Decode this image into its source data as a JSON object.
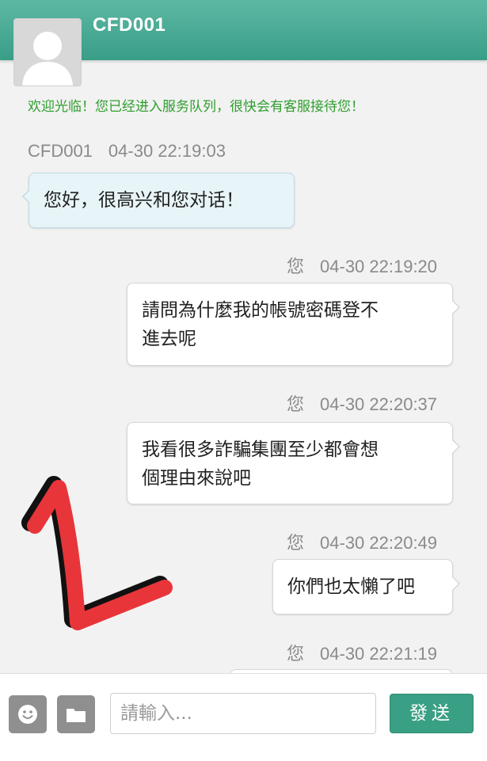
{
  "header": {
    "title": "CFD001",
    "bg_color": "#3fa58e"
  },
  "welcome_text": "欢迎光临！您已经进入服务队列，很快会有客服接待您！",
  "messages": [
    {
      "sender": "CFD001",
      "time": "04-30 22:19:03",
      "lines": [
        "您好，很高兴和您对话！"
      ]
    },
    {
      "sender": "您",
      "time": "04-30 22:19:20",
      "lines": [
        "請問為什麼我的帳號密碼登不",
        "進去呢"
      ]
    },
    {
      "sender": "您",
      "time": "04-30 22:20:37",
      "lines": [
        "我看很多詐騙集團至少都會想",
        "個理由來說吧"
      ]
    },
    {
      "sender": "您",
      "time": "04-30 22:20:49",
      "lines": [
        "你們也太懶了吧"
      ]
    },
    {
      "sender": "您",
      "time": "04-30 22:21:19",
      "lines": []
    }
  ],
  "annotation": {
    "label": "1",
    "color": "#e8353a"
  },
  "input": {
    "placeholder": "請輸入..."
  },
  "buttons": {
    "emoji_icon": "smiley-icon",
    "folder_icon": "folder-icon",
    "send_label": "發送",
    "send_color": "#3aa085"
  }
}
